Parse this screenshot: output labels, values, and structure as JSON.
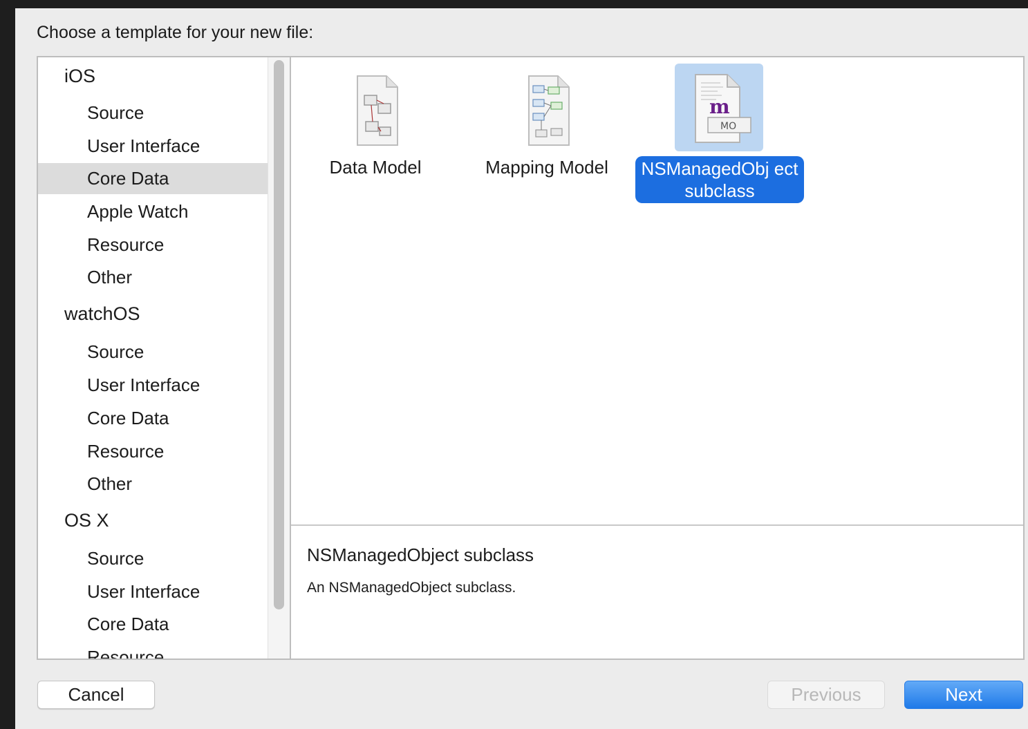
{
  "dialog": {
    "prompt": "Choose a template for your new file:"
  },
  "sidebar": {
    "groups": [
      {
        "label": "iOS",
        "items": [
          "Source",
          "User Interface",
          "Core Data",
          "Apple Watch",
          "Resource",
          "Other"
        ]
      },
      {
        "label": "watchOS",
        "items": [
          "Source",
          "User Interface",
          "Core Data",
          "Resource",
          "Other"
        ]
      },
      {
        "label": "OS X",
        "items": [
          "Source",
          "User Interface",
          "Core Data",
          "Resource"
        ]
      }
    ],
    "selected": "iOS / Core Data"
  },
  "templates": [
    {
      "label": "Data Model",
      "icon": "data-model-file-icon",
      "selected": false
    },
    {
      "label": "Mapping Model",
      "icon": "mapping-model-file-icon",
      "selected": false
    },
    {
      "label": "NSManagedObject subclass",
      "label_display": "NSManagedObj ect subclass",
      "icon": "managed-object-file-icon",
      "icon_text": "MO",
      "icon_letter": "m",
      "selected": true
    }
  ],
  "description": {
    "title": "NSManagedObject subclass",
    "text": "An NSManagedObject subclass."
  },
  "buttons": {
    "cancel": "Cancel",
    "previous": "Previous",
    "next": "Next"
  },
  "colors": {
    "accent": "#1c6ee0",
    "selection_highlight": "#bcd6f2",
    "sidebar_selection": "#dcdcdc"
  }
}
